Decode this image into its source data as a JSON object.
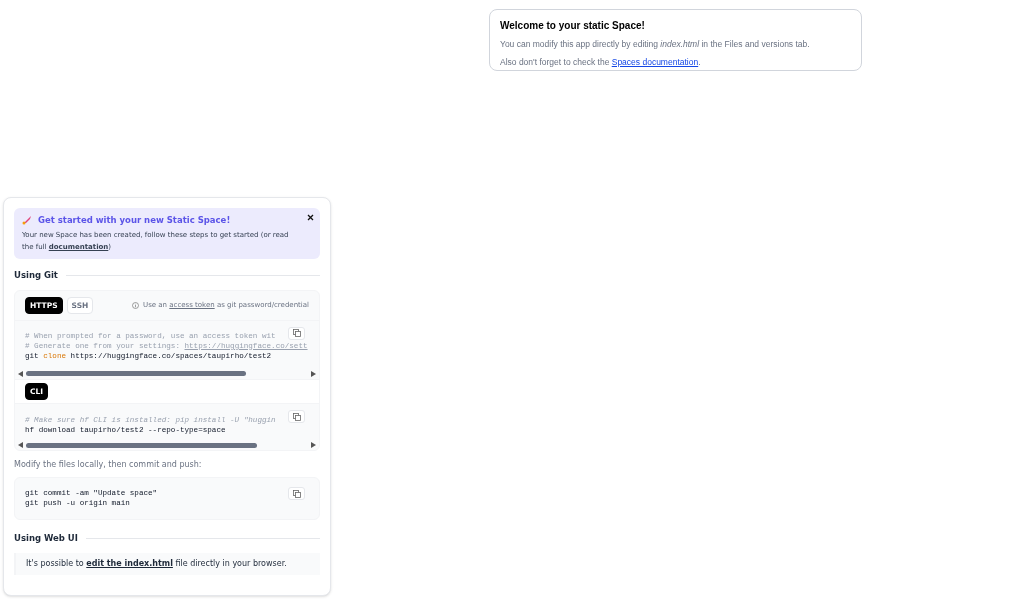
{
  "welcome": {
    "title": "Welcome to your static Space!",
    "line1": "You can modify this app directly by editing *index.html* in the Files and versions tab.",
    "line2_before": "Also don't forget to check the ",
    "line2_link": "Spaces documentation",
    "line2_after": "."
  },
  "banner": {
    "title": "Get started with your new Static Space!",
    "text": "Your new Space has been created, follow these steps to get started (or read the full ",
    "link": "documentation",
    "text_after": ")"
  },
  "git_section": {
    "title": "Using Git",
    "tabs": [
      {
        "label": "HTTPS",
        "selected": true
      },
      {
        "label": "SSH",
        "selected": false
      }
    ],
    "hint_before": "Use an ",
    "hint_link": "access token",
    "hint_after": " as git password/credential",
    "code_lines": [
      {
        "kind": "comment",
        "text": "# When prompted for a password, use an access token wit"
      },
      {
        "kind": "comment_link",
        "text": "# Generate one from your settings: ",
        "link": "https://huggingface.co/sett"
      },
      {
        "kind": "command",
        "cmd": "git ",
        "keyword": "clone",
        "rest": " https://huggingface.co/spaces/taupirho/test2"
      }
    ]
  },
  "cli_section": {
    "tabs": [
      {
        "label": "CLI",
        "selected": true
      }
    ],
    "code_lines": [
      {
        "kind": "comment_italic",
        "text": "# Make sure hf CLI is installed: pip install -U \"huggin"
      },
      {
        "kind": "plain",
        "text": "hf download taupirho/test2 --repo-type=space"
      }
    ]
  },
  "push_note": "Modify the files locally, then commit and push:",
  "push_lines": [
    "git commit -am \"Update space\"",
    "git push -u origin main"
  ],
  "web_section": {
    "title": "Using Web UI",
    "text_before": "It's possible to ",
    "link": "edit the index.html",
    "text_after": " file directly in your browser."
  }
}
